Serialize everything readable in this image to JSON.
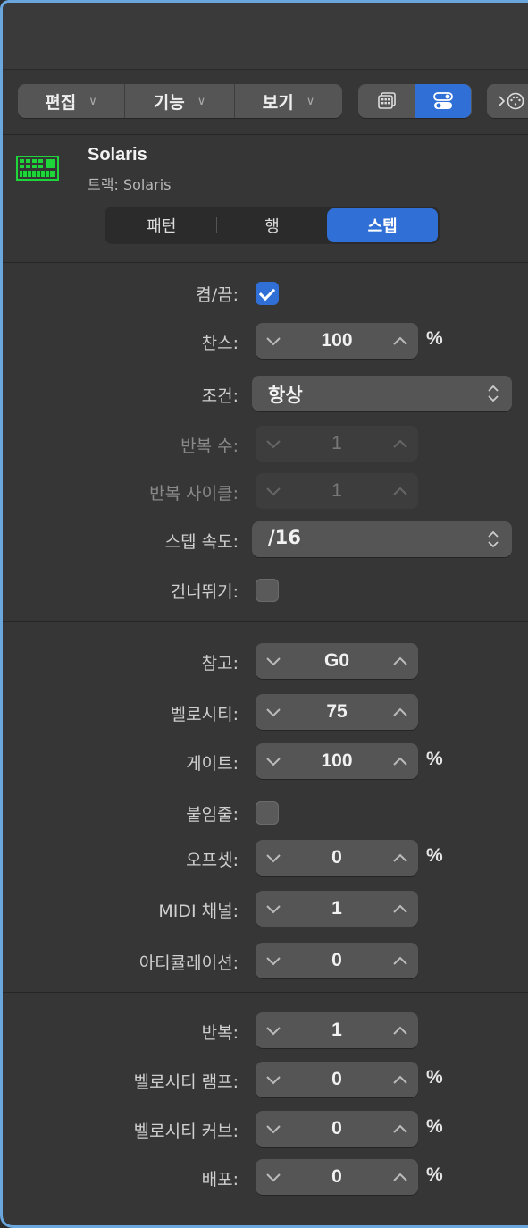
{
  "toolbar": {
    "menus": [
      {
        "label": "편집"
      },
      {
        "label": "기능"
      },
      {
        "label": "보기"
      }
    ]
  },
  "track": {
    "name": "Solaris",
    "subtitle": "트랙: Solaris",
    "icon_color": "#1fd63a"
  },
  "tabs": [
    {
      "label": "패턴",
      "active": false
    },
    {
      "label": "행",
      "active": false
    },
    {
      "label": "스텝",
      "active": true
    }
  ],
  "step_section": {
    "on_off": {
      "label": "켬/끔:",
      "checked": true
    },
    "chance": {
      "label": "찬스:",
      "value": "100",
      "unit": "%"
    },
    "condition": {
      "label": "조건:",
      "value": "항상"
    },
    "repeat_count": {
      "label": "반복 수:",
      "value": "1"
    },
    "repeat_cycle": {
      "label": "반복 사이클:",
      "value": "1"
    },
    "step_rate": {
      "label": "스텝 속도:",
      "value": "/16"
    },
    "skip": {
      "label": "건너뛰기:",
      "checked": false
    }
  },
  "note_section": {
    "note": {
      "label": "참고:",
      "value": "G0"
    },
    "velocity": {
      "label": "벨로시티:",
      "value": "75"
    },
    "gate": {
      "label": "게이트:",
      "value": "100",
      "unit": "%"
    },
    "tie": {
      "label": "붙임줄:",
      "checked": false
    },
    "offset": {
      "label": "오프셋:",
      "value": "0",
      "unit": "%"
    },
    "midi_channel": {
      "label": "MIDI 채널:",
      "value": "1"
    },
    "articulation": {
      "label": "아티큘레이션:",
      "value": "0"
    }
  },
  "repeat_section": {
    "repeat": {
      "label": "반복:",
      "value": "1"
    },
    "velocity_ramp": {
      "label": "벨로시티 램프:",
      "value": "0",
      "unit": "%"
    },
    "velocity_curve": {
      "label": "벨로시티 커브:",
      "value": "0",
      "unit": "%"
    },
    "spread": {
      "label": "배포:",
      "value": "0",
      "unit": "%"
    }
  },
  "colors": {
    "accent": "#2f6fd6",
    "panel": "#363636",
    "control": "#555555"
  }
}
